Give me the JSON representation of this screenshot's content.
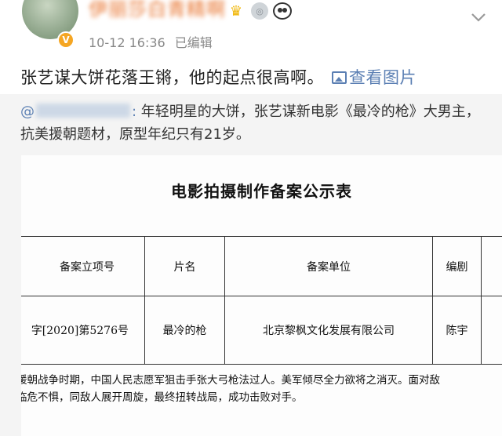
{
  "post": {
    "username": "伊丽莎白青精啊",
    "verified_mark": "V",
    "badges": [
      "crown-badge",
      "member-badge",
      "panda-badge"
    ],
    "timestamp": "10-12 16:36",
    "edited_label": "已编辑",
    "text": "张艺谋大饼花落王锵，他的起点很高啊。",
    "view_image_label": "查看图片"
  },
  "repost": {
    "at_sign": "@",
    "colon": ":",
    "text": " 年轻明星的大饼，张艺谋新电影《最冷的枪》大男主，抗美援朝题材，原型年纪只有21岁。",
    "document": {
      "title": "电影拍摄制作备案公示表",
      "headers": [
        "备案立项号",
        "片名",
        "备案单位",
        "编剧",
        ""
      ],
      "row": [
        "字[2020]第5276号",
        "最冷的枪",
        "北京黎枫文化发展有限公司",
        "陈宇",
        ""
      ],
      "description_line1": "援朝战争时期，中国人民志愿军狙击手张大弓枪法过人。美军倾尽全力欲将之消灭。面对敌",
      "description_line2": "临危不惧，同敌人展开周旋，最终扭转战局，成功击败对手。"
    }
  },
  "colors": {
    "username": "#e8742f",
    "link": "#5b7fb3",
    "meta": "#888888",
    "repost_bg": "#f4f4f4"
  }
}
